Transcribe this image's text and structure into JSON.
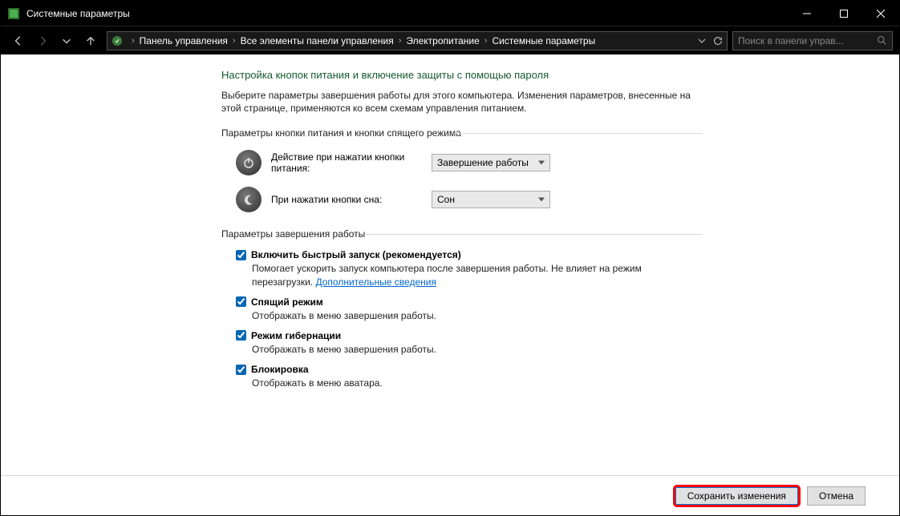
{
  "window": {
    "title": "Системные параметры"
  },
  "breadcrumb": {
    "items": [
      "Панель управления",
      "Все элементы панели управления",
      "Электропитание",
      "Системные параметры"
    ]
  },
  "search": {
    "placeholder": "Поиск в панели управ..."
  },
  "page": {
    "heading": "Настройка кнопок питания и включение защиты с помощью пароля",
    "description": "Выберите параметры завершения работы для этого компьютера. Изменения параметров, внесенные на этой странице, применяются ко всем схемам управления питанием."
  },
  "group1": {
    "label": "Параметры кнопки питания и кнопки спящего режима",
    "powerButton": {
      "label": "Действие при нажатии кнопки питания:",
      "value": "Завершение работы"
    },
    "sleepButton": {
      "label": "При нажатии кнопки сна:",
      "value": "Сон"
    }
  },
  "group2": {
    "label": "Параметры завершения работы",
    "fastStartup": {
      "title": "Включить быстрый запуск (рекомендуется)",
      "sub": "Помогает ускорить запуск компьютера после завершения работы. Не влияет на режим перезагрузки. ",
      "link": "Дополнительные сведения"
    },
    "sleep": {
      "title": "Спящий режим",
      "sub": "Отображать в меню завершения работы."
    },
    "hibernate": {
      "title": "Режим гибернации",
      "sub": "Отображать в меню завершения работы."
    },
    "lock": {
      "title": "Блокировка",
      "sub": "Отображать в меню аватара."
    }
  },
  "footer": {
    "save": "Сохранить изменения",
    "cancel": "Отмена"
  }
}
